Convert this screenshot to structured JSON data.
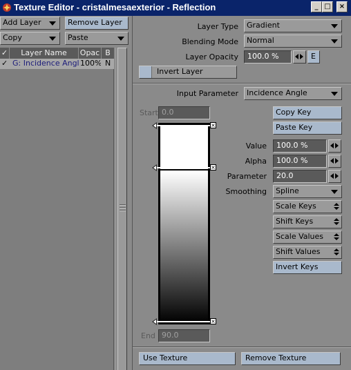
{
  "window": {
    "title": "Texture Editor - cristalmesaexterior - Reflection",
    "controls": {
      "minimize": "_",
      "maximize": "□",
      "close": "×"
    }
  },
  "left": {
    "add_layer": "Add Layer",
    "remove_layer": "Remove Layer",
    "copy": "Copy",
    "paste": "Paste",
    "table": {
      "headers": {
        "check": "✓",
        "name": "Layer Name",
        "opac": "Opac",
        "blend": "B"
      },
      "rows": [
        {
          "check": "✓",
          "name": "G: Incidence Angle",
          "opac": "100%",
          "blend": "N"
        }
      ]
    }
  },
  "right": {
    "layer_type": {
      "label": "Layer Type",
      "value": "Gradient"
    },
    "blending_mode": {
      "label": "Blending Mode",
      "value": "Normal"
    },
    "layer_opacity": {
      "label": "Layer Opacity",
      "value": "100.0 %",
      "env_button": "E"
    },
    "invert_layer": "Invert Layer",
    "input_parameter": {
      "label": "Input Parameter",
      "value": "Incidence Angle"
    },
    "start": {
      "label": "Start",
      "value": "0.0"
    },
    "end": {
      "label": "End",
      "value": "90.0"
    },
    "copy_key": "Copy Key",
    "paste_key": "Paste Key",
    "value": {
      "label": "Value",
      "value": "100.0 %"
    },
    "alpha": {
      "label": "Alpha",
      "value": "100.0 %"
    },
    "parameter": {
      "label": "Parameter",
      "value": "20.0"
    },
    "smoothing": {
      "label": "Smoothing",
      "value": "Spline"
    },
    "scale_keys": "Scale Keys",
    "shift_keys": "Shift Keys",
    "scale_values": "Scale Values",
    "shift_values": "Shift Values",
    "invert_keys": "Invert Keys",
    "use_texture": "Use Texture",
    "remove_texture": "Remove Texture"
  }
}
